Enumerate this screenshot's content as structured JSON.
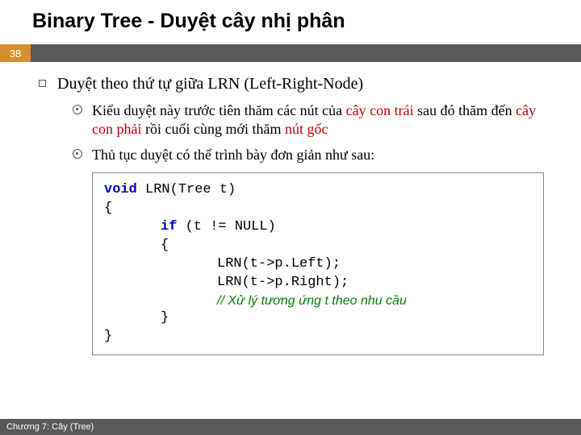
{
  "title": "Binary Tree - Duyệt cây nhị phân",
  "pageNum": "38",
  "lvl1": "Duyệt theo thứ tự giữa LRN (Left-Right-Node)",
  "b1_pre": "Kiểu duyệt này trước tiên thăm các nút của ",
  "b1_hl1": "cây con trái",
  "b1_mid": " sau đó thăm đến ",
  "b1_hl2": "cây con phải",
  "b1_mid2": " rồi cuối cùng mới thăm ",
  "b1_hl3": "nút gốc",
  "b2": "Thủ tục duyệt có thể trình bày đơn giản như sau:",
  "code": {
    "l1_kw": "void",
    "l1_rest": "  LRN(Tree t)",
    "l2": "{",
    "l3_kw": "if",
    "l3_rest": " (t != NULL)",
    "l4": "{",
    "l5": "LRN(t->p.Left);",
    "l6": "LRN(t->p.Right);",
    "l7": "// Xử lý tương ứng t theo nhu cầu",
    "l8": "}",
    "l9": "}"
  },
  "footer": "Chương 7: Cây (Tree)"
}
